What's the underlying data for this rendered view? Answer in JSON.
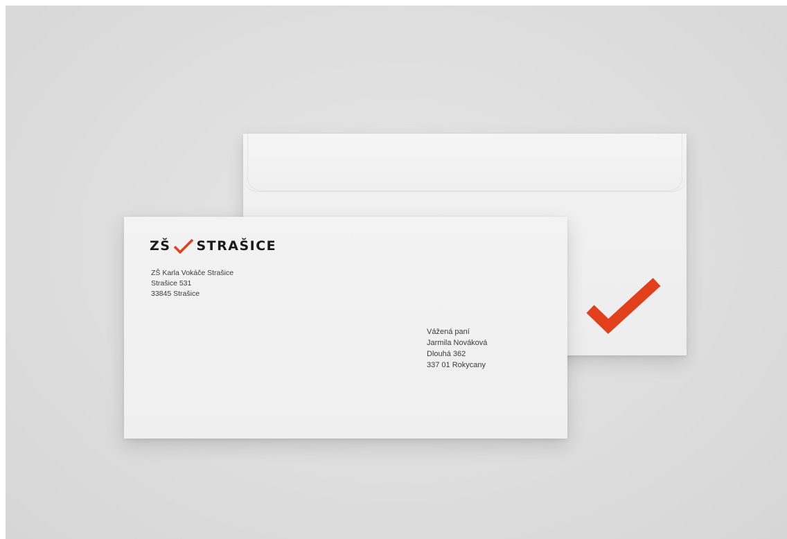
{
  "logo": {
    "prefix": "ZŠ",
    "name": "STRAŠICE",
    "accent_color": "#e2401c"
  },
  "sender": {
    "line1": "ZŠ Karla Vokáče Strašice",
    "line2": "Strašice 531",
    "line3": "33845 Strašice"
  },
  "recipient": {
    "line1": "Vážená paní",
    "line2": "Jarmila Nováková",
    "line3": "Dlouhá 362",
    "line4": "337 01 Rokycany"
  },
  "colors": {
    "background": "#dddddd",
    "paper": "#f1f1f1",
    "text": "#1b1b1b",
    "accent": "#e2401c"
  },
  "icons": {
    "back_mark": "checkmark-icon",
    "logo_mark": "checkmark-icon"
  }
}
